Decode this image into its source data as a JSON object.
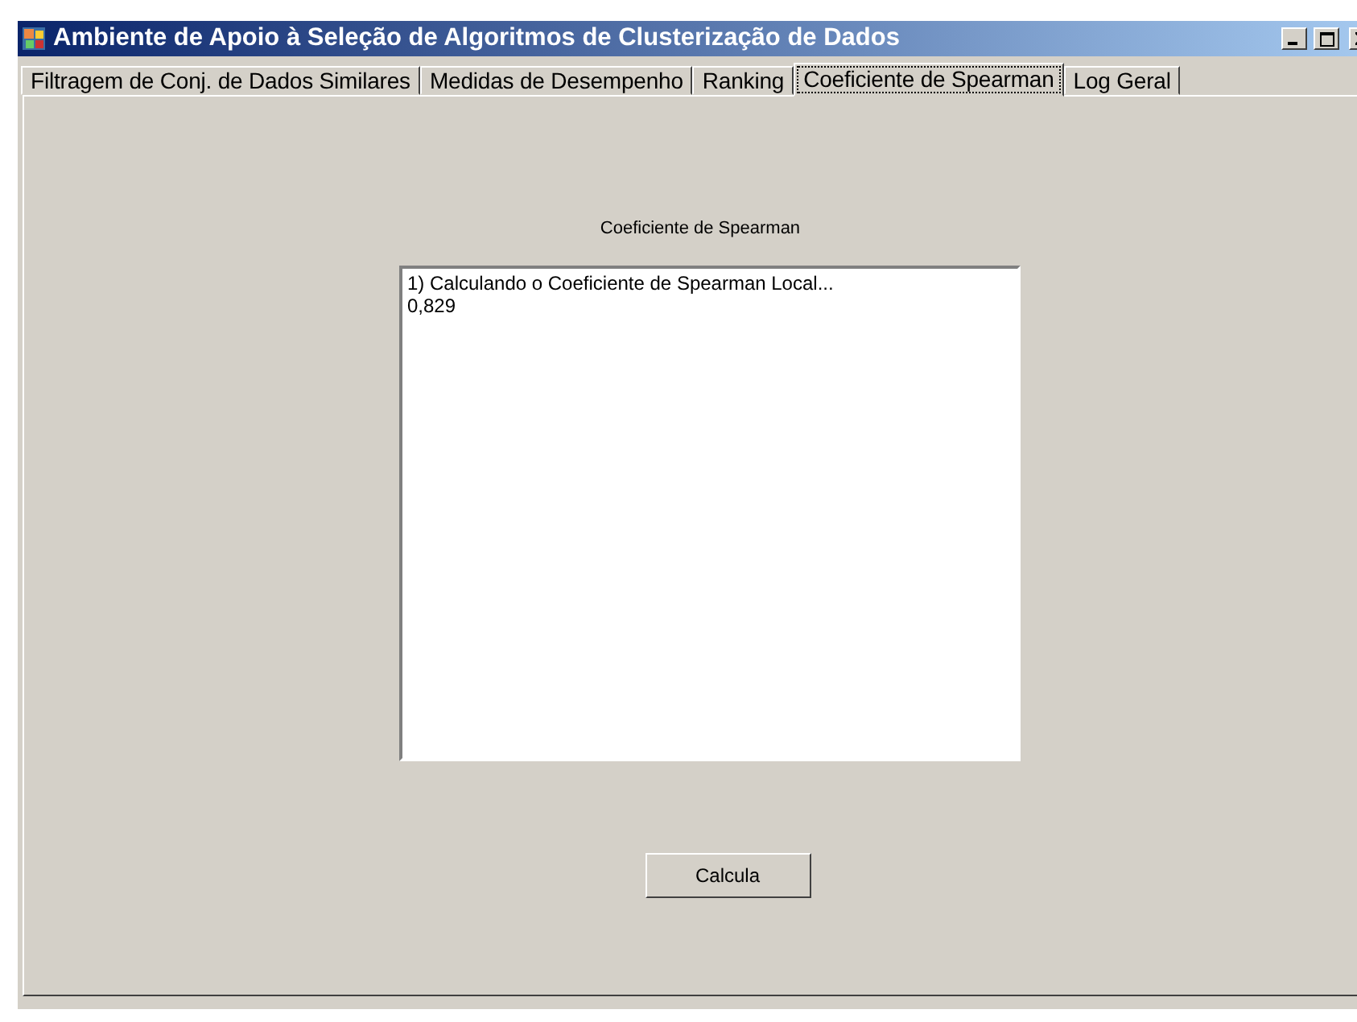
{
  "window": {
    "title": "Ambiente de Apoio à Seleção de Algoritmos de Clusterização de Dados"
  },
  "tabs": [
    {
      "label": "Filtragem de Conj. de Dados Similares",
      "selected": false
    },
    {
      "label": "Medidas de Desempenho",
      "selected": false
    },
    {
      "label": "Ranking",
      "selected": false
    },
    {
      "label": "Coeficiente de Spearman",
      "selected": true
    },
    {
      "label": "Log Geral",
      "selected": false
    }
  ],
  "panel": {
    "heading": "Coeficiente de Spearman",
    "output_lines": [
      "1) Calculando o Coeficiente de Spearman Local...",
      "0,829"
    ],
    "button": "Calcula"
  }
}
